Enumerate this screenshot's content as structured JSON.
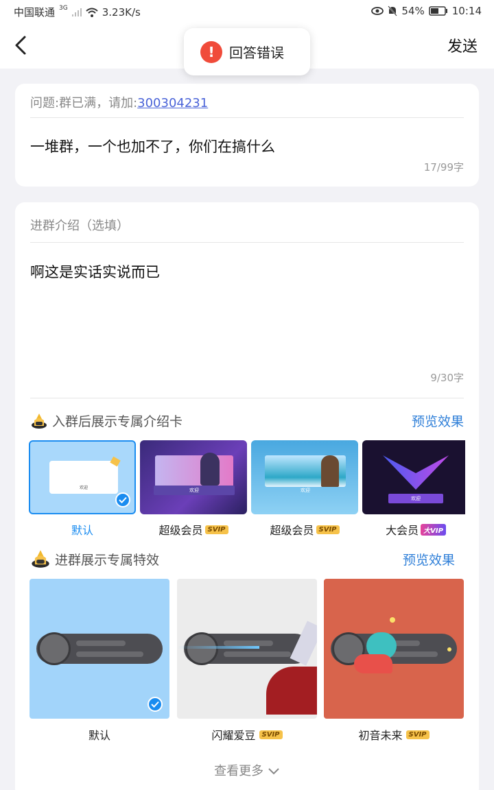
{
  "status_bar": {
    "carrier": "中国联通",
    "network": "3G",
    "speed": "3.23K/s",
    "battery": "54%",
    "time": "10:14"
  },
  "nav": {
    "send_label": "发送"
  },
  "toast": {
    "icon": "!",
    "text": "回答错误"
  },
  "question": {
    "prefix": "问题:群已满，请加:",
    "link": "300304231",
    "answer": "一堆群，一个也加不了，你们在搞什么",
    "counter": "17/99字"
  },
  "intro": {
    "label": "进群介绍（选填）",
    "text": "啊这是实话实说而已",
    "counter": "9/30字"
  },
  "intro_card_section": {
    "title": "入群后展示专属介绍卡",
    "preview": "预览效果",
    "cards": [
      {
        "label": "默认",
        "badge": "",
        "welcome": "欢迎"
      },
      {
        "label": "超级会员",
        "badge": "SVIP",
        "welcome": "欢迎"
      },
      {
        "label": "超级会员",
        "badge": "SVIP",
        "welcome": "欢迎"
      },
      {
        "label": "大会员",
        "badge": "大VIP",
        "welcome": "欢迎"
      }
    ]
  },
  "effect_section": {
    "title": "进群展示专属特效",
    "preview": "预览效果",
    "effects": [
      {
        "label": "默认",
        "badge": ""
      },
      {
        "label": "闪耀爱豆",
        "badge": "SVIP"
      },
      {
        "label": "初音未来",
        "badge": "SVIP"
      }
    ]
  },
  "more_label": "查看更多",
  "colors": {
    "accent_blue": "#2f7fd8",
    "selected_label": "#1a8cf0",
    "error_red": "#f04b3a",
    "svip_gold": "#f6c24a"
  }
}
